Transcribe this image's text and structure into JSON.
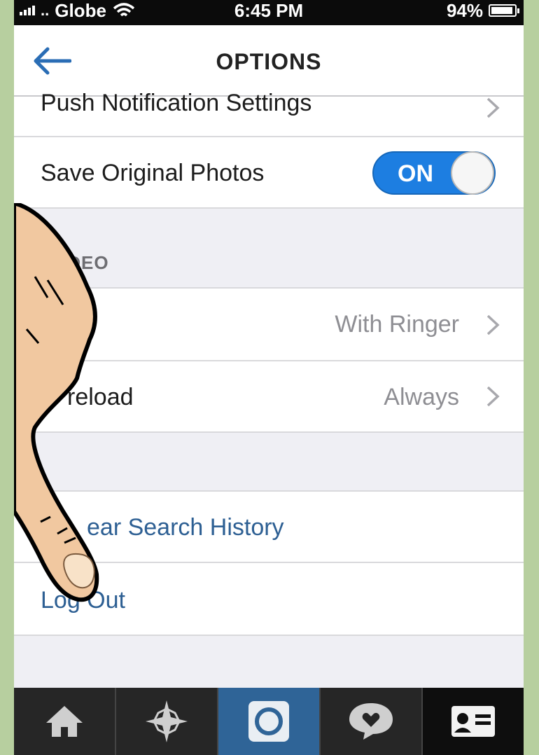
{
  "status_bar": {
    "carrier": "Globe",
    "time": "6:45 PM",
    "battery_percent": "94%",
    "battery_level": 0.94
  },
  "nav": {
    "title": "OPTIONS"
  },
  "rows": {
    "push_notifications": {
      "label": "Push Notification Settings"
    },
    "save_original_photos": {
      "label": "Save Original Photos",
      "toggle_text": "ON"
    },
    "video_section": {
      "header": "IDEO"
    },
    "sound": {
      "value": "With Ringer"
    },
    "preload": {
      "label": "reload",
      "value": "Always"
    },
    "clear_search_history": {
      "label": "ear Search History"
    },
    "log_out": {
      "label": "Log Out"
    }
  },
  "tab_bar": {
    "tabs": [
      {
        "icon": "home-icon"
      },
      {
        "icon": "explore-star-icon"
      },
      {
        "icon": "camera-icon",
        "active": true
      },
      {
        "icon": "news-heart-icon"
      },
      {
        "icon": "profile-card-icon"
      }
    ]
  },
  "colors": {
    "accent_blue": "#1d7ee1",
    "link_blue": "#2d5f93",
    "active_tab": "#2f6497",
    "background_green": "#b7cf9f"
  }
}
